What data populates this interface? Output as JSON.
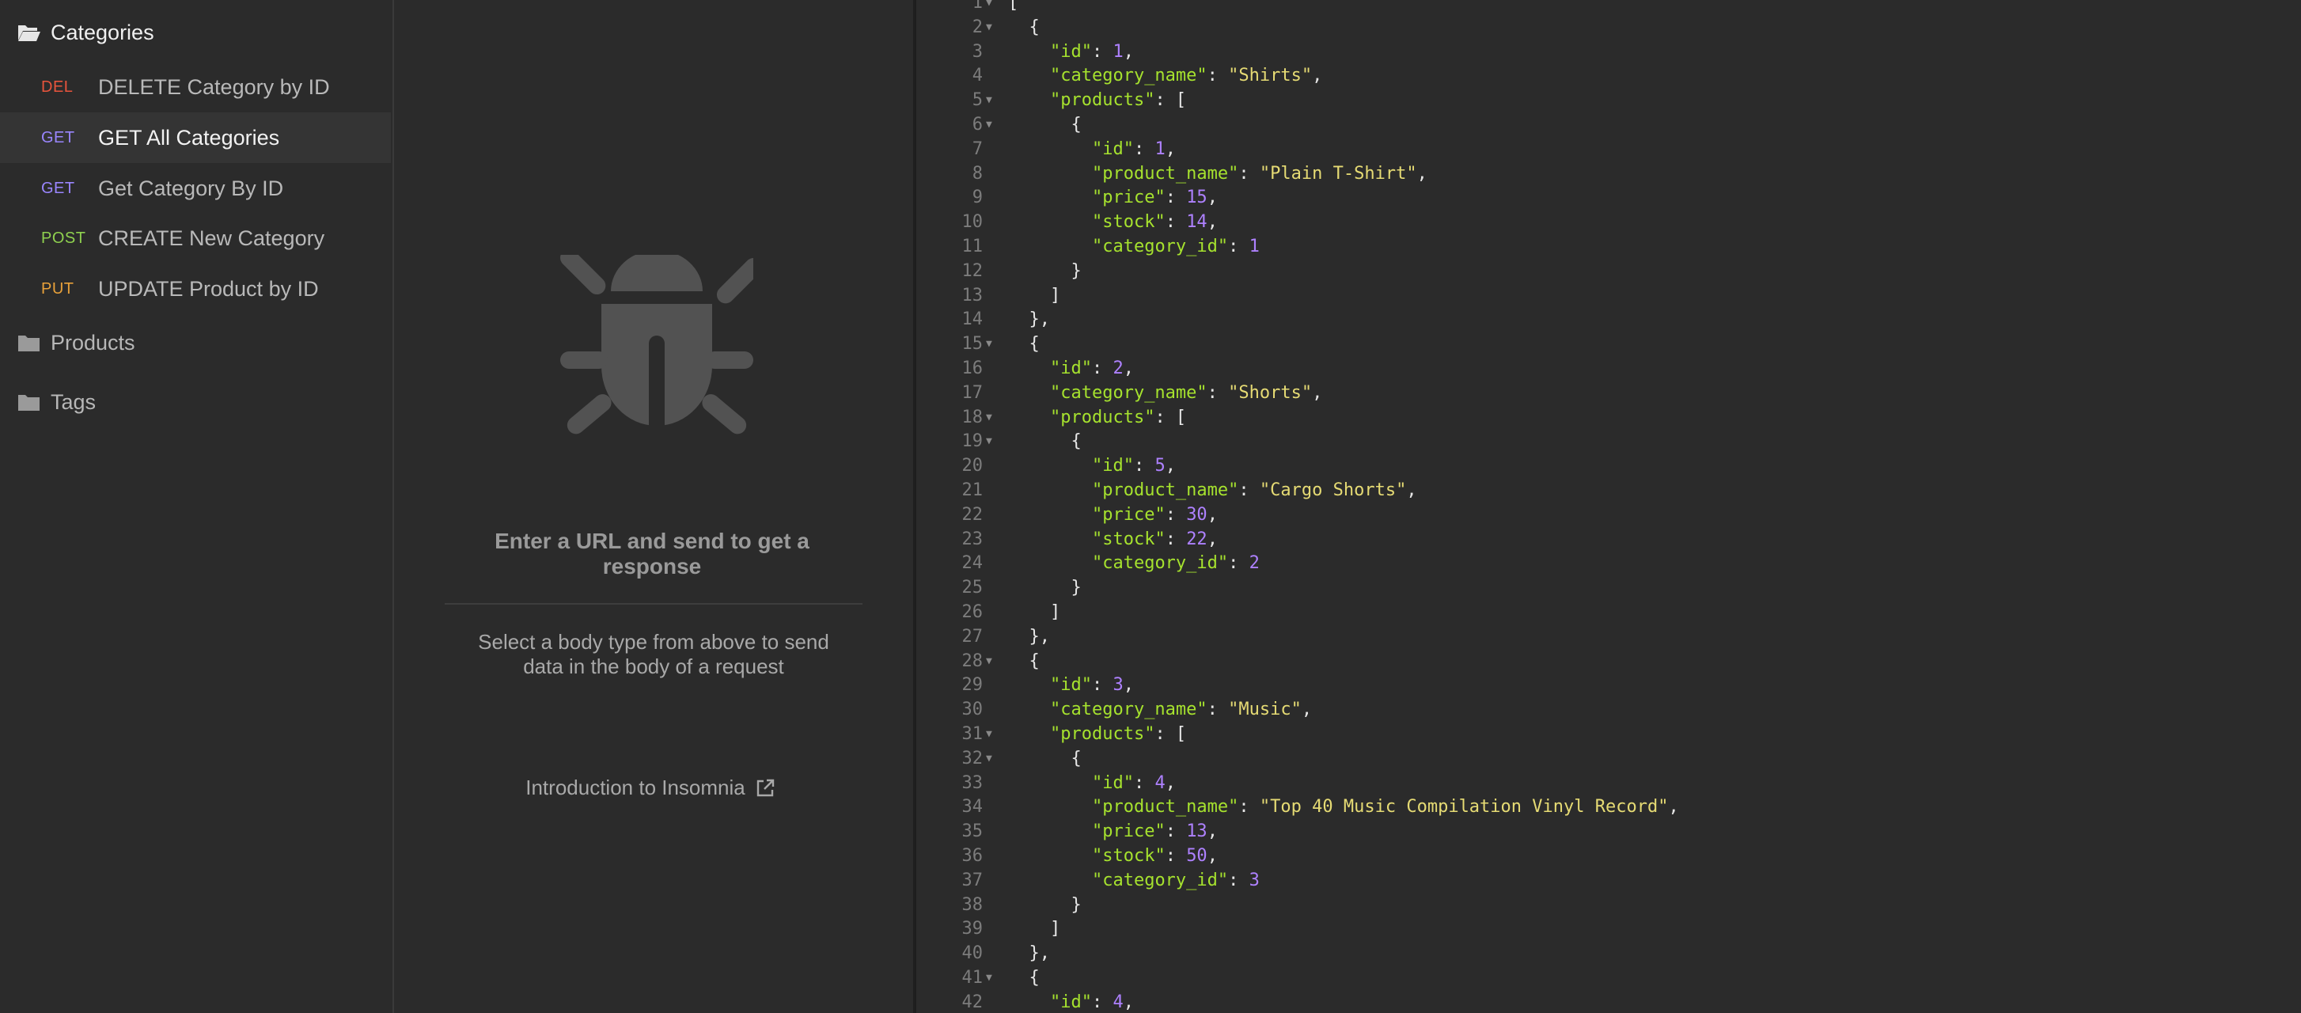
{
  "sidebar": {
    "folders": [
      {
        "label": "Categories",
        "open": true
      },
      {
        "label": "Products",
        "open": false
      },
      {
        "label": "Tags",
        "open": false
      }
    ],
    "requests": [
      {
        "method": "DEL",
        "method_color": "#e8543c",
        "label": "DELETE Category by ID",
        "active": false
      },
      {
        "method": "GET",
        "method_color": "#9a86ff",
        "label": "GET All Categories",
        "active": true
      },
      {
        "method": "GET",
        "method_color": "#9a86ff",
        "label": "Get Category By ID",
        "active": false
      },
      {
        "method": "POST",
        "method_color": "#8fd14f",
        "label": "CREATE New Category",
        "active": false
      },
      {
        "method": "PUT",
        "method_color": "#e8a13a",
        "label": "UPDATE Product by ID",
        "active": false
      }
    ]
  },
  "middle": {
    "empty_title": "Enter a URL and send to get a response",
    "empty_sub": "Select a body type from above to send data in the body of a request",
    "intro_link": "Introduction to Insomnia"
  },
  "response": {
    "lines": [
      {
        "n": "1",
        "fold": true,
        "t": "["
      },
      {
        "n": "2",
        "fold": true,
        "t": "  {"
      },
      {
        "n": "3",
        "t": "    \"id\": 1,"
      },
      {
        "n": "4",
        "t": "    \"category_name\": \"Shirts\","
      },
      {
        "n": "5",
        "fold": true,
        "t": "    \"products\": ["
      },
      {
        "n": "6",
        "fold": true,
        "t": "      {"
      },
      {
        "n": "7",
        "t": "        \"id\": 1,"
      },
      {
        "n": "8",
        "t": "        \"product_name\": \"Plain T-Shirt\","
      },
      {
        "n": "9",
        "t": "        \"price\": 15,"
      },
      {
        "n": "10",
        "t": "        \"stock\": 14,"
      },
      {
        "n": "11",
        "t": "        \"category_id\": 1"
      },
      {
        "n": "12",
        "t": "      }"
      },
      {
        "n": "13",
        "t": "    ]"
      },
      {
        "n": "14",
        "t": "  },"
      },
      {
        "n": "15",
        "fold": true,
        "t": "  {"
      },
      {
        "n": "16",
        "t": "    \"id\": 2,"
      },
      {
        "n": "17",
        "t": "    \"category_name\": \"Shorts\","
      },
      {
        "n": "18",
        "fold": true,
        "t": "    \"products\": ["
      },
      {
        "n": "19",
        "fold": true,
        "t": "      {"
      },
      {
        "n": "20",
        "t": "        \"id\": 5,"
      },
      {
        "n": "21",
        "t": "        \"product_name\": \"Cargo Shorts\","
      },
      {
        "n": "22",
        "t": "        \"price\": 30,"
      },
      {
        "n": "23",
        "t": "        \"stock\": 22,"
      },
      {
        "n": "24",
        "t": "        \"category_id\": 2"
      },
      {
        "n": "25",
        "t": "      }"
      },
      {
        "n": "26",
        "t": "    ]"
      },
      {
        "n": "27",
        "t": "  },"
      },
      {
        "n": "28",
        "fold": true,
        "t": "  {"
      },
      {
        "n": "29",
        "t": "    \"id\": 3,"
      },
      {
        "n": "30",
        "t": "    \"category_name\": \"Music\","
      },
      {
        "n": "31",
        "fold": true,
        "t": "    \"products\": ["
      },
      {
        "n": "32",
        "fold": true,
        "t": "      {"
      },
      {
        "n": "33",
        "t": "        \"id\": 4,"
      },
      {
        "n": "34",
        "t": "        \"product_name\": \"Top 40 Music Compilation Vinyl Record\","
      },
      {
        "n": "35",
        "t": "        \"price\": 13,"
      },
      {
        "n": "36",
        "t": "        \"stock\": 50,"
      },
      {
        "n": "37",
        "t": "        \"category_id\": 3"
      },
      {
        "n": "38",
        "t": "      }"
      },
      {
        "n": "39",
        "t": "    ]"
      },
      {
        "n": "40",
        "t": "  },"
      },
      {
        "n": "41",
        "fold": true,
        "t": "  {"
      },
      {
        "n": "42",
        "t": "    \"id\": 4,"
      }
    ]
  }
}
